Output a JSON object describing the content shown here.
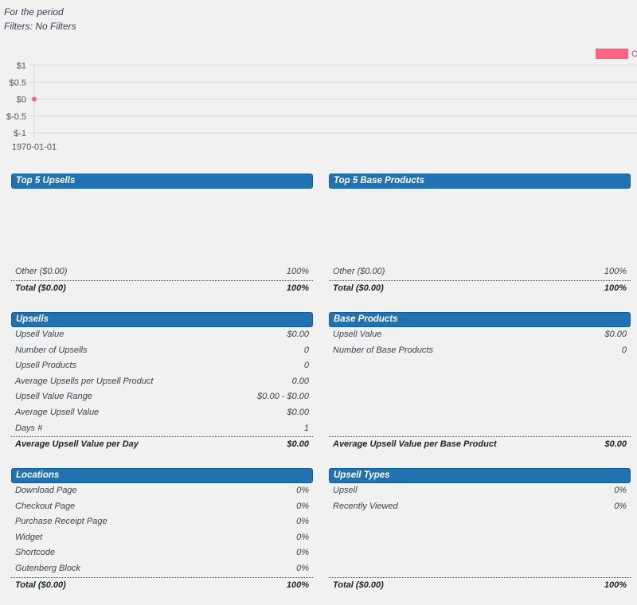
{
  "intro": {
    "period": "For the period",
    "filters": "Filters: No Filters"
  },
  "chart_data": {
    "type": "line",
    "x": [
      "1970-01-01"
    ],
    "series": [
      {
        "values": [
          0
        ],
        "color": "#ff6384"
      }
    ],
    "y_ticks": [
      "$1",
      "$0.5",
      "$0",
      "$-0.5",
      "$-1"
    ],
    "ylim": [
      -1,
      1
    ],
    "grid": true,
    "legend_placement": "top-right",
    "legend_text": "O"
  },
  "top_upsells": {
    "title": "Top 5 Upsells",
    "other_label": "Other  ($0.00)",
    "other_value": "100%",
    "total_label": "Total  ($0.00)",
    "total_value": "100%"
  },
  "top_base_products": {
    "title": "Top 5 Base Products",
    "other_label": "Other  ($0.00)",
    "other_value": "100%",
    "total_label": "Total  ($0.00)",
    "total_value": "100%"
  },
  "upsells": {
    "title": "Upsells",
    "rows": [
      {
        "label": "Upsell Value",
        "value": "$0.00"
      },
      {
        "label": "Number of Upsells",
        "value": "0"
      },
      {
        "label": "Upsell Products",
        "value": "0"
      },
      {
        "label": "Average Upsells per Upsell Product",
        "value": "0.00"
      },
      {
        "label": "Upsell Value Range",
        "value": "$0.00 - $0.00"
      },
      {
        "label": "Average Upsell Value",
        "value": "$0.00"
      },
      {
        "label": "Days #",
        "value": "1"
      }
    ],
    "total_label": "Average Upsell Value per Day",
    "total_value": "$0.00"
  },
  "base_products": {
    "title": "Base Products",
    "rows": [
      {
        "label": "Upsell Value",
        "value": "$0.00"
      },
      {
        "label": "Number of Base Products",
        "value": "0"
      }
    ],
    "total_label": "Average Upsell Value per Base Product",
    "total_value": "$0.00"
  },
  "locations": {
    "title": "Locations",
    "rows": [
      {
        "label": "Download Page",
        "value": "0%"
      },
      {
        "label": "Checkout Page",
        "value": "0%"
      },
      {
        "label": "Purchase Receipt Page",
        "value": "0%"
      },
      {
        "label": "Widget",
        "value": "0%"
      },
      {
        "label": "Shortcode",
        "value": "0%"
      },
      {
        "label": "Gutenberg Block",
        "value": "0%"
      }
    ],
    "total_label": "Total  ($0.00)",
    "total_value": "100%"
  },
  "upsell_types": {
    "title": "Upsell Types",
    "rows": [
      {
        "label": "Upsell",
        "value": "0%"
      },
      {
        "label": "Recently Viewed",
        "value": "0%"
      }
    ],
    "total_label": "Total  ($0.00)",
    "total_value": "100%"
  }
}
